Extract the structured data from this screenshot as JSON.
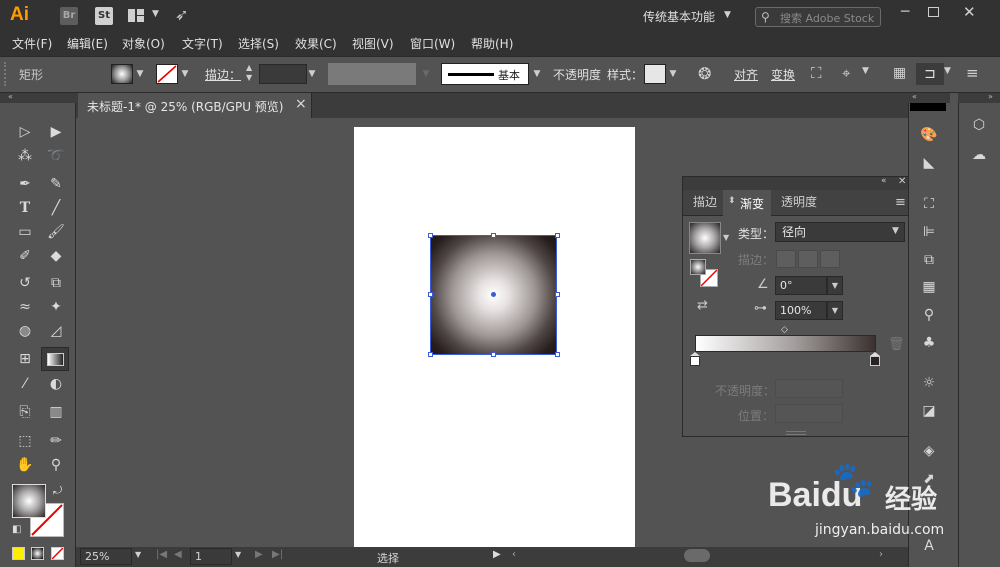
{
  "app": {
    "logo": "Ai",
    "badges": [
      "Br",
      "St"
    ]
  },
  "titlebar": {
    "workspace": "传统基本功能",
    "search_placeholder": "搜索 Adobe Stock"
  },
  "menu": [
    "文件(F)",
    "编辑(E)",
    "对象(O)",
    "文字(T)",
    "选择(S)",
    "效果(C)",
    "视图(V)",
    "窗口(W)",
    "帮助(H)"
  ],
  "control": {
    "object_type": "矩形",
    "stroke_label": "描边：",
    "brush_label": "基本",
    "opacity_label": "不透明度",
    "style_label": "样式：",
    "align_label": "对齐",
    "transform_label": "变换"
  },
  "document": {
    "tab_title": "未标题-1* @ 25% (RGB/GPU 预览)",
    "close": "×"
  },
  "status": {
    "zoom": "25%",
    "page": "1",
    "mode": "选择"
  },
  "gradient_panel": {
    "tabs": [
      "描边",
      "渐变",
      "透明度"
    ],
    "active_tab": "渐变",
    "type_label": "类型：",
    "type_value": "径向",
    "stroke_label": "描边：",
    "angle_value": "0°",
    "aspect_value": "100%",
    "opacity_label": "不透明度：",
    "location_label": "位置："
  },
  "watermark": {
    "brand": "Baidu",
    "cn": "经验",
    "url": "jingyan.baidu.com"
  },
  "colors": {
    "accent": "#ff9a00",
    "selection": "#3b5bdb",
    "chrome_dark": "#323232",
    "chrome": "#535353"
  }
}
